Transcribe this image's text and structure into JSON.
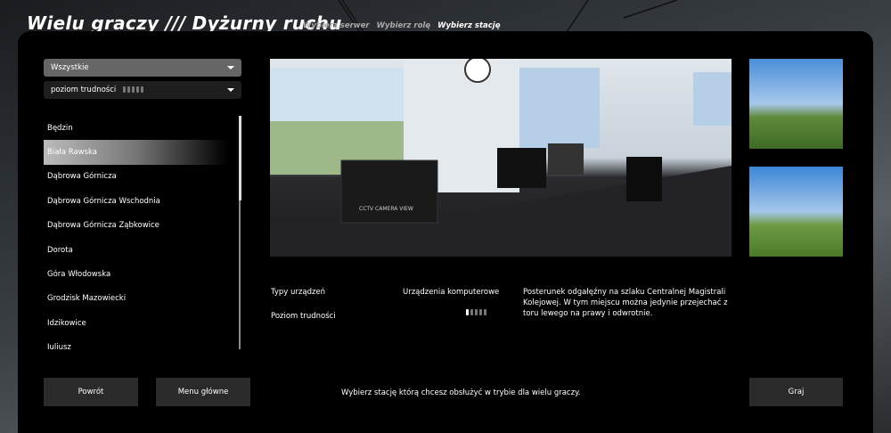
{
  "header": {
    "title": "Wielu graczy /// Dyżurny ruchu",
    "breadcrumbs": [
      "Wybierz serwer",
      "Wybierz rolę",
      "Wybierz stację"
    ]
  },
  "filters": {
    "category": "Wszystkie",
    "difficulty_label": "poziom trudności",
    "difficulty_filter_pips": 5
  },
  "stations": [
    "Będzin",
    "Biała Rawska",
    "Dąbrowa Górnicza",
    "Dąbrowa Górnicza Wschodnia",
    "Dąbrowa Górnicza Ząbkowice",
    "Dorota",
    "Góra Włodowska",
    "Grodzisk Mazowiecki",
    "Idzikowice",
    "Juliusz"
  ],
  "selected_station": "Biała Rawska",
  "details": {
    "device_type_label": "Typy urządzeń",
    "device_type_value": "Urządzenia komputerowe",
    "difficulty_label": "Poziom trudności",
    "difficulty_value": 1,
    "difficulty_max": 5,
    "description": "Posterunek odgałęźny na szlaku Centralnej Magistrali Kolejowej. W tym miejscu można jedynie przejechać z toru lewego na prawy i odwrotnie.",
    "monitor_text": "CCTV CAMERA VIEW"
  },
  "footer": {
    "back": "Powrót",
    "main_menu": "Menu główne",
    "hint": "Wybierz stację którą chcesz obsłużyć w trybie dla wielu graczy.",
    "play": "Graj"
  }
}
